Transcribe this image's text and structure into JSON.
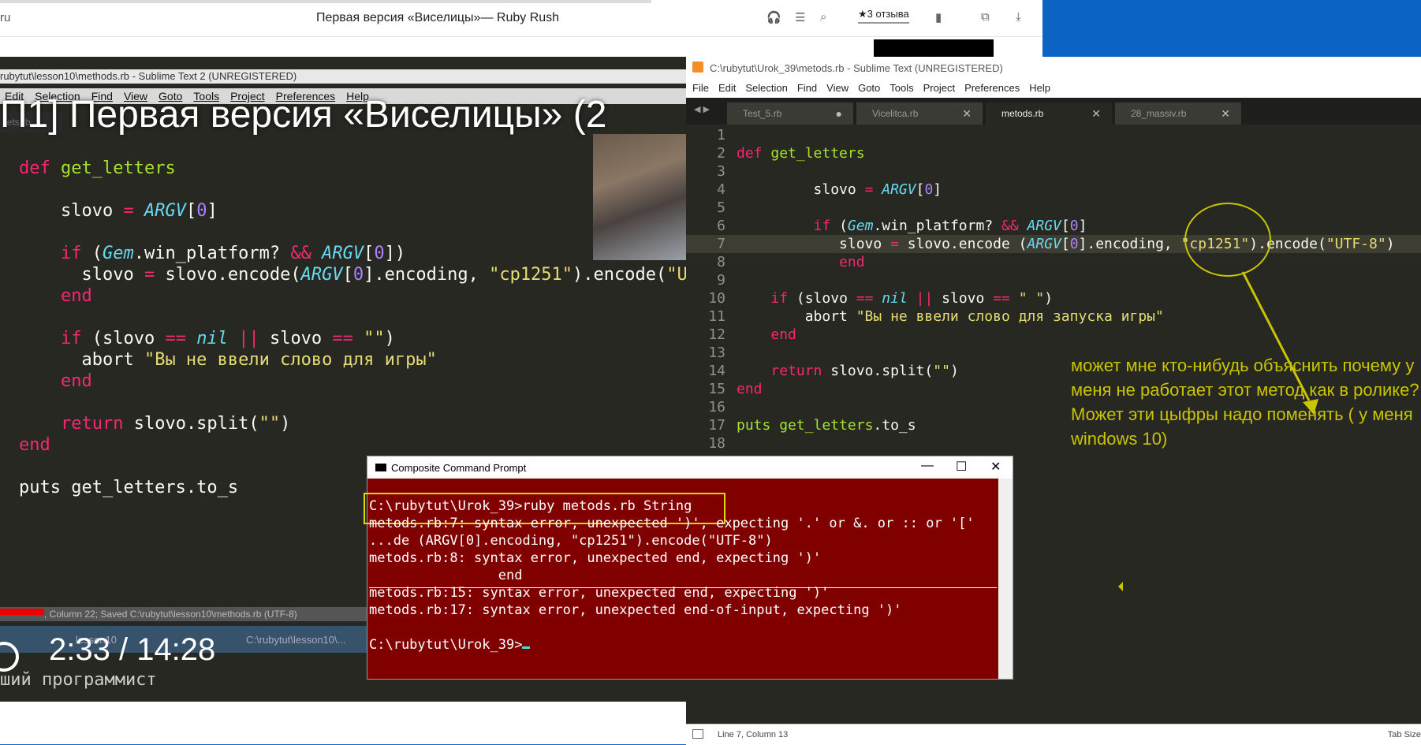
{
  "browser": {
    "domain": "ru",
    "title": "Первая версия «Виселицы»— Ruby Rush",
    "reviews": "★3 отзыва"
  },
  "video": {
    "st_title": "rubytut\\lesson10\\methods.rb - Sublime Text 2 (UNREGISTERED)",
    "st_menu": [
      "Edit",
      "Selection",
      "Find",
      "View",
      "Goto",
      "Tools",
      "Project",
      "Preferences",
      "Help"
    ],
    "big_title": "П1] Первая версия «Виселицы» (2",
    "tab_label": "lets.rb",
    "code_lines": [
      "def get_letters",
      "",
      "  slovo = ARGV[0]",
      "",
      "  if (Gem.win_platform? && ARGV[0])",
      "    slovo = slovo.encode(ARGV[0].encoding, \"cp1251\").encode(\"U",
      "  end",
      "",
      "  if (slovo == nil || slovo == \"\")",
      "    abort \"Вы не ввели слово для игры\"",
      "  end",
      "",
      "  return slovo.split(\"\")",
      "end",
      "",
      "puts get_letters.to_s"
    ],
    "status_text": ", Column 22; Saved C:\\rubytut\\lesson10\\methods.rb (UTF-8)",
    "task1": "lesson10",
    "task2": "C:\\rubytut\\lesson10\\...",
    "time": "2:33 / 14:28",
    "channel": "ший программист"
  },
  "sublime": {
    "title": "C:\\rubytut\\Urok_39\\metods.rb - Sublime Text (UNREGISTERED)",
    "menu": [
      "File",
      "Edit",
      "Selection",
      "Find",
      "View",
      "Goto",
      "Tools",
      "Project",
      "Preferences",
      "Help"
    ],
    "tabs": [
      {
        "label": "Test_5.rb",
        "mark": "●"
      },
      {
        "label": "Vicelitca.rb",
        "mark": "✕"
      },
      {
        "label": "metods.rb",
        "mark": "✕"
      },
      {
        "label": "28_massiv.rb",
        "mark": "✕"
      }
    ],
    "line_numbers": [
      "1",
      "2",
      "3",
      "4",
      "5",
      "6",
      "7",
      "8",
      "9",
      "10",
      "11",
      "12",
      "13",
      "14",
      "15",
      "16",
      "17",
      "18"
    ],
    "status": "Line 7, Column 13",
    "status_right": "Tab Size"
  },
  "annotation": {
    "text": "может мне кто-нибудь объяснить почему у меня не работает этот метод как в ролике? Может эти цыфры надо поменять ( у меня windows 10)"
  },
  "cmd": {
    "title": "Composite Command Prompt",
    "lines": [
      "C:\\rubytut\\Urok_39>ruby metods.rb String",
      "metods.rb:7: syntax error, unexpected ')', expecting '.' or &. or :: or '['",
      "...de (ARGV[0].encoding, \"cp1251\").encode(\"UTF-8\")",
      "metods.rb:8: syntax error, unexpected end, expecting ')'",
      "                end",
      "metods.rb:15: syntax error, unexpected end, expecting ')'",
      "metods.rb:17: syntax error, unexpected end-of-input, expecting ')'",
      "",
      "C:\\rubytut\\Urok_39>"
    ]
  },
  "colors": {
    "keyword": "#f92672",
    "function": "#a6e22e",
    "constant": "#66d9ef",
    "number": "#ae81ff",
    "string": "#e6db74",
    "annotation": "#c8c400",
    "cmd_bg": "#800000"
  }
}
